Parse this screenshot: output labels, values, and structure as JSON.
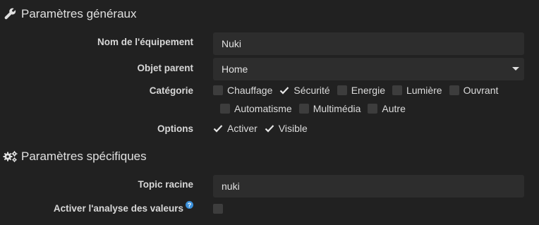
{
  "general": {
    "title": "Paramètres généraux",
    "icon": "wrench-icon",
    "name_label": "Nom de l'équipement",
    "name_value": "Nuki",
    "parent_label": "Objet parent",
    "parent_value": "Home",
    "category_label": "Catégorie",
    "categories": [
      {
        "label": "Chauffage",
        "checked": false
      },
      {
        "label": "Sécurité",
        "checked": true
      },
      {
        "label": "Energie",
        "checked": false
      },
      {
        "label": "Lumière",
        "checked": false
      },
      {
        "label": "Ouvrant",
        "checked": false
      },
      {
        "label": "Automatisme",
        "checked": false
      },
      {
        "label": "Multimédia",
        "checked": false
      },
      {
        "label": "Autre",
        "checked": false
      }
    ],
    "options_label": "Options",
    "options": [
      {
        "label": "Activer",
        "checked": true
      },
      {
        "label": "Visible",
        "checked": true
      }
    ]
  },
  "specific": {
    "title": "Paramètres spécifiques",
    "icon": "gears-icon",
    "topic_label": "Topic racine",
    "topic_value": "nuki",
    "analysis_label": "Activer l'analyse des valeurs",
    "analysis_checked": false
  },
  "colors": {
    "background": "#212121",
    "input_bg": "#2d2d2d",
    "help_icon": "#3a8fd9"
  }
}
